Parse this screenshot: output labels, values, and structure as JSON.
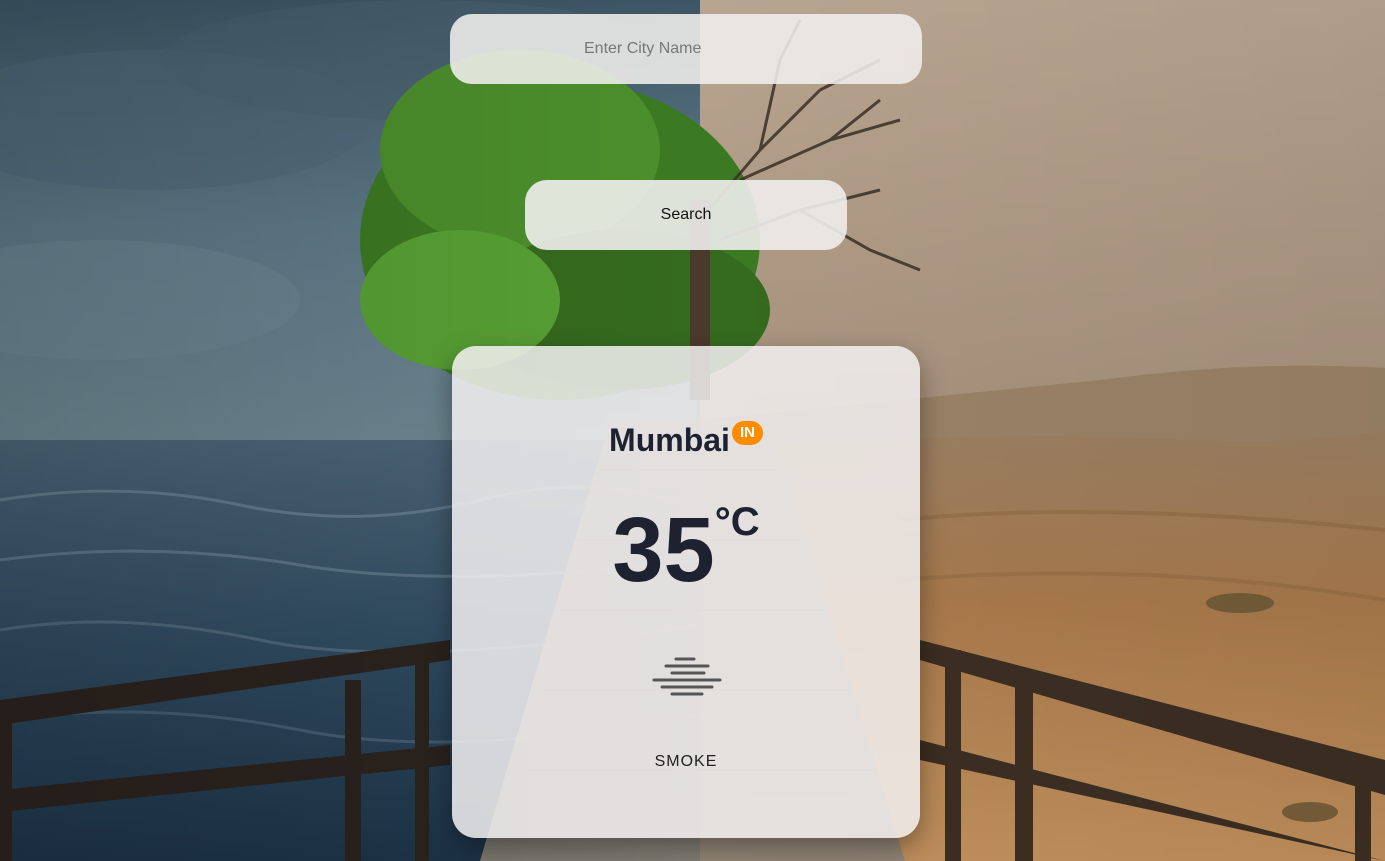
{
  "search": {
    "placeholder": "Enter City Name",
    "value": "",
    "button_label": "Search"
  },
  "weather": {
    "city": "Mumbai",
    "country_code": "IN",
    "temperature": "35",
    "unit": "°C",
    "condition": "SMOKE",
    "icon": "smoke-icon"
  },
  "colors": {
    "badge": "#ff8c00",
    "text_dark": "#1e2130"
  }
}
